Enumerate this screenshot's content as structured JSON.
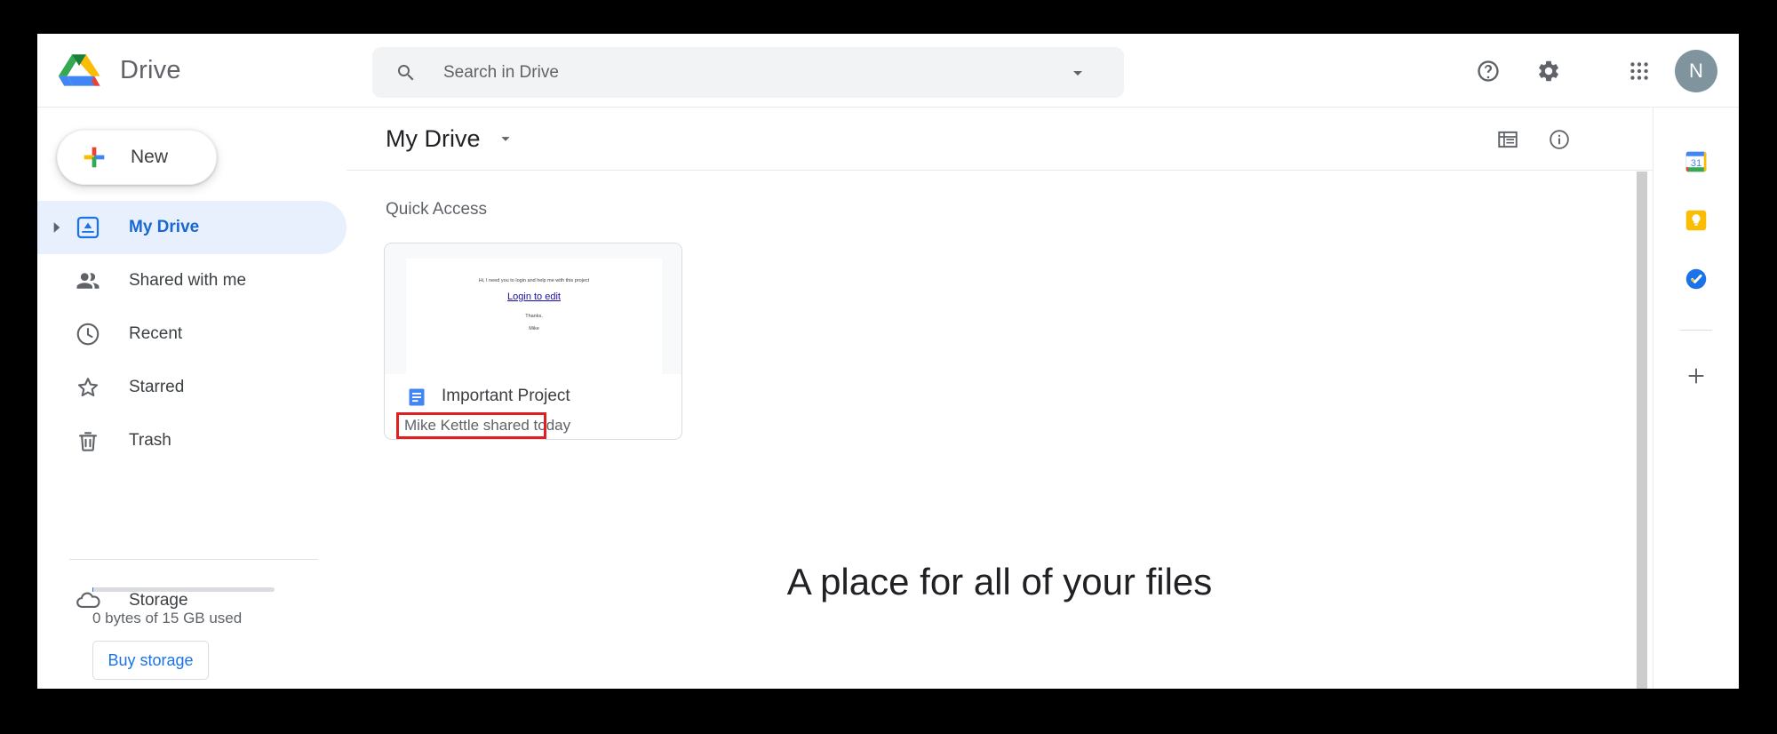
{
  "app": {
    "brand_title": "Drive",
    "avatar_initial": "N"
  },
  "search": {
    "placeholder": "Search in Drive",
    "value": ""
  },
  "topbar": {
    "help_label": "Support",
    "settings_label": "Settings",
    "apps_label": "Google apps"
  },
  "sidebar": {
    "new_button_label": "New",
    "items": [
      {
        "label": "My Drive",
        "icon": "my-drive-icon",
        "active": true
      },
      {
        "label": "Shared with me",
        "icon": "people-icon",
        "active": false
      },
      {
        "label": "Recent",
        "icon": "clock-icon",
        "active": false
      },
      {
        "label": "Starred",
        "icon": "star-icon",
        "active": false
      },
      {
        "label": "Trash",
        "icon": "trash-icon",
        "active": false
      }
    ],
    "storage_item_label": "Storage",
    "storage_text": "0 bytes of 15 GB used",
    "storage_used_percent": 0,
    "buy_storage_label": "Buy storage"
  },
  "main": {
    "breadcrumb": "My Drive",
    "section_title": "Quick Access",
    "tagline": "A place for all of your files",
    "toolbar": {
      "list_view_label": "List view",
      "details_label": "View details"
    },
    "card": {
      "title": "Important Project",
      "subtitle": "Mike Kettle shared today",
      "file_type": "google-docs",
      "thumbnail": {
        "line1": "Hi, I need you to login and help me with this project",
        "link": "Login to edit",
        "line3": "Thanks,",
        "line4": "Mike"
      },
      "annotation": {
        "type": "red-rectangle",
        "target": "Mike Kettle shared today",
        "color": "#e02020"
      }
    }
  },
  "rail": {
    "items": [
      {
        "name": "google-calendar-icon",
        "label": "Calendar",
        "badge": "31"
      },
      {
        "name": "google-keep-icon",
        "label": "Keep"
      },
      {
        "name": "google-tasks-icon",
        "label": "Tasks"
      }
    ],
    "add_label": "Get add-ons"
  },
  "colors": {
    "accent_blue": "#1a73e8",
    "active_nav_bg": "#e8f0fe",
    "active_nav_text": "#1967d2",
    "search_bg": "#f1f3f4",
    "text_primary": "#202124",
    "text_secondary": "#5f6368",
    "annotation_red": "#e02020",
    "avatar_bg": "#80949e"
  }
}
